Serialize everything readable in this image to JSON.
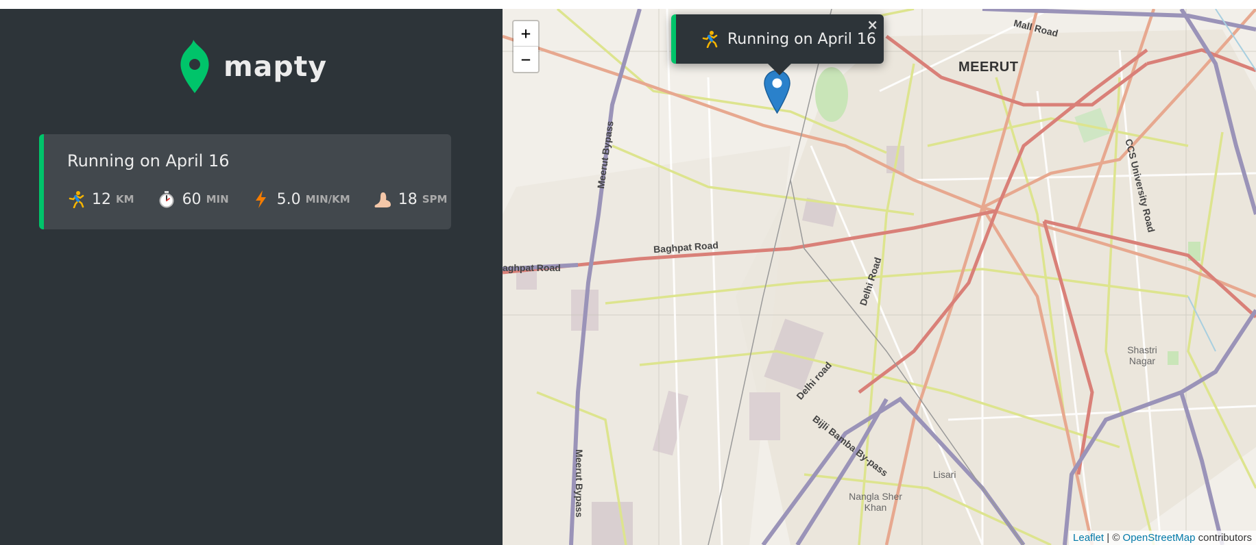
{
  "brand": {
    "name": "mapty",
    "accent": "#00c46a"
  },
  "workouts": [
    {
      "title": "Running on April 16",
      "type": "running",
      "details": [
        {
          "icon": "running-icon",
          "value": "12",
          "unit": "km"
        },
        {
          "icon": "stopwatch-icon",
          "value": "60",
          "unit": "min"
        },
        {
          "icon": "lightning-icon",
          "value": "5.0",
          "unit": "min/km"
        },
        {
          "icon": "footprint-icon",
          "value": "18",
          "unit": "spm"
        }
      ]
    }
  ],
  "map": {
    "zoom_in_label": "+",
    "zoom_out_label": "−",
    "popup": {
      "text": "Running on April 16",
      "close_label": "×"
    },
    "labels": {
      "city": "MEERUT",
      "mall_road": "Mall Road",
      "meerut_bypass_1": "Meerut Bypass",
      "meerut_bypass_2": "Meerut Bypass",
      "baghpat_road_1": "Baghpat Road",
      "baghpat_road_2": "aghpat Road",
      "delhi_road_1": "Delhi Road",
      "delhi_road_2": "Delhi road",
      "ccs_road": "CCS University Road",
      "bypass": "Bijli Bamba By-pass",
      "shastri_nagar": "Shastri Nagar",
      "nangla": "Nangla Sher Khan",
      "lisari": "Lisari"
    },
    "attribution": {
      "leaflet": "Leaflet",
      "separator": " | © ",
      "osm": "OpenStreetMap",
      "suffix": " contributors"
    }
  }
}
